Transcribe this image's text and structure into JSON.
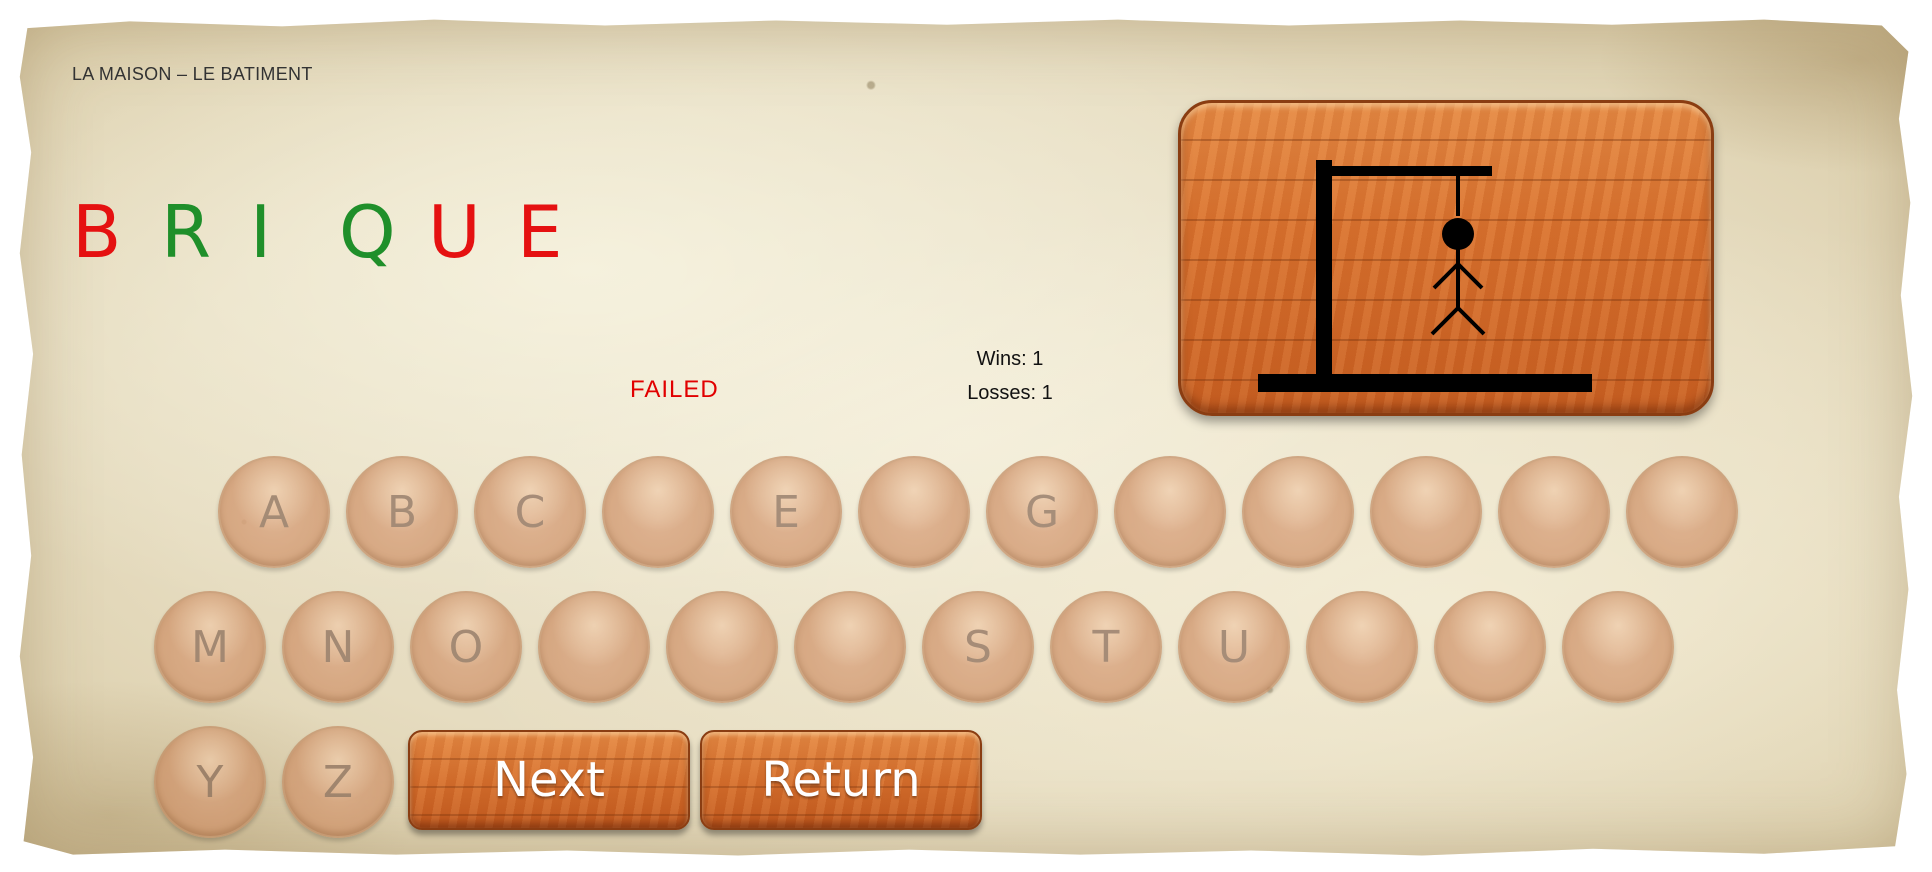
{
  "header": {
    "category": "LA MAISON – LE BATIMENT"
  },
  "word": {
    "letters": [
      {
        "char": "B",
        "color": "#e51111"
      },
      {
        "char": "R",
        "color": "#1f8f2a"
      },
      {
        "char": "I",
        "color": "#1f8f2a"
      },
      {
        "char": "Q",
        "color": "#1f8f2a"
      },
      {
        "char": "U",
        "color": "#e51111"
      },
      {
        "char": "E",
        "color": "#e51111"
      }
    ]
  },
  "status": {
    "text": "FAILED",
    "color": "#e10000"
  },
  "score": {
    "wins": "Wins: 1",
    "losses": "Losses: 1"
  },
  "board": {
    "icon": "gallows-hangman-icon"
  },
  "keyboard": {
    "row1": [
      "A",
      "B",
      "C",
      "",
      "E",
      "",
      "G",
      "",
      "",
      "",
      "",
      ""
    ],
    "row2": [
      "M",
      "N",
      "O",
      "",
      "",
      "",
      "S",
      "T",
      "U",
      "",
      "",
      ""
    ],
    "row3": [
      "Y",
      "Z"
    ]
  },
  "actions": {
    "next_label": "Next",
    "return_label": "Return"
  },
  "colors": {
    "wood": "#d9722f",
    "key": "#cf9268",
    "parchment": "#e6dcc0"
  }
}
